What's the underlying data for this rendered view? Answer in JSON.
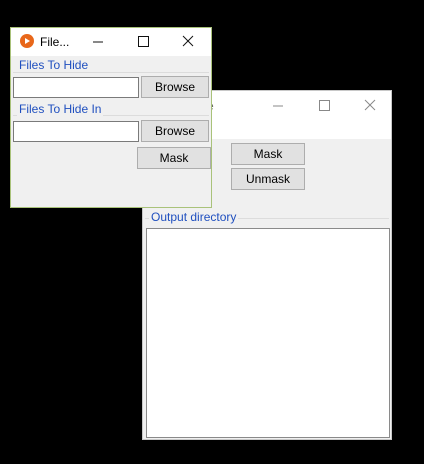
{
  "back_window": {
    "title_partial": "e",
    "mask_button": "Mask",
    "unmask_button": "Unmask",
    "output_group_label": "Output directory"
  },
  "front_window": {
    "title": "File...",
    "group1_label": "Files To Hide",
    "group1_browse": "Browse",
    "group2_label": "Files To Hide In",
    "group2_browse": "Browse",
    "mask_button": "Mask",
    "field1_value": "",
    "field2_value": ""
  },
  "colors": {
    "accent_label": "#1f4fbf",
    "app_icon": "#e8671a",
    "front_border": "#a9c27a"
  },
  "icons": [
    "app-icon",
    "minimize-icon",
    "maximize-icon",
    "close-icon"
  ]
}
